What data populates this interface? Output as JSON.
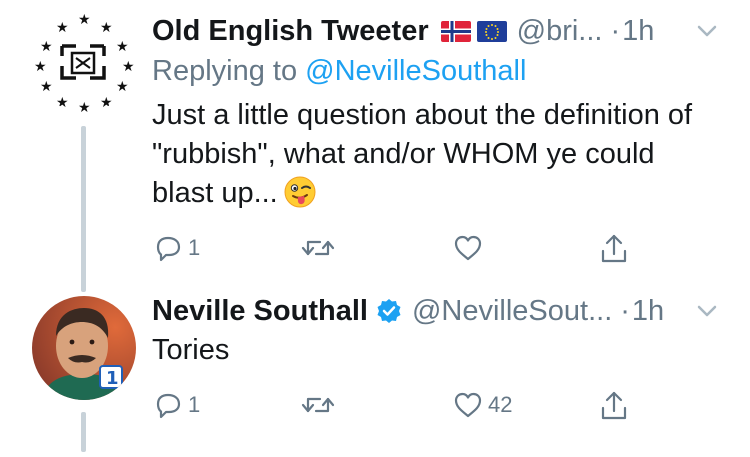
{
  "tweet1": {
    "display_name": "Old English Tweeter",
    "flags": [
      "norway-flag-icon",
      "eu-flag-icon"
    ],
    "handle": "@bri...",
    "separator": "·",
    "time": "1h",
    "replying_prefix": "Replying to",
    "replying_to": "@NevilleSouthall",
    "text": "Just a little question about the definition of \"rubbish\", what and/or WHOM ye could blast up...",
    "emoji": "winking-face-with-tongue-icon",
    "actions": {
      "reply_count": "1",
      "retweet_count": "",
      "like_count": ""
    }
  },
  "tweet2": {
    "display_name": "Neville Southall",
    "verified": true,
    "handle": "@NevilleSout...",
    "separator": "·",
    "time": "1h",
    "text": "Tories",
    "actions": {
      "reply_count": "1",
      "retweet_count": "",
      "like_count": "42"
    }
  },
  "colors": {
    "link": "#1da1f2",
    "secondary": "#657786",
    "thread_line": "#c8d2d9",
    "verified": "#1da1f2"
  }
}
